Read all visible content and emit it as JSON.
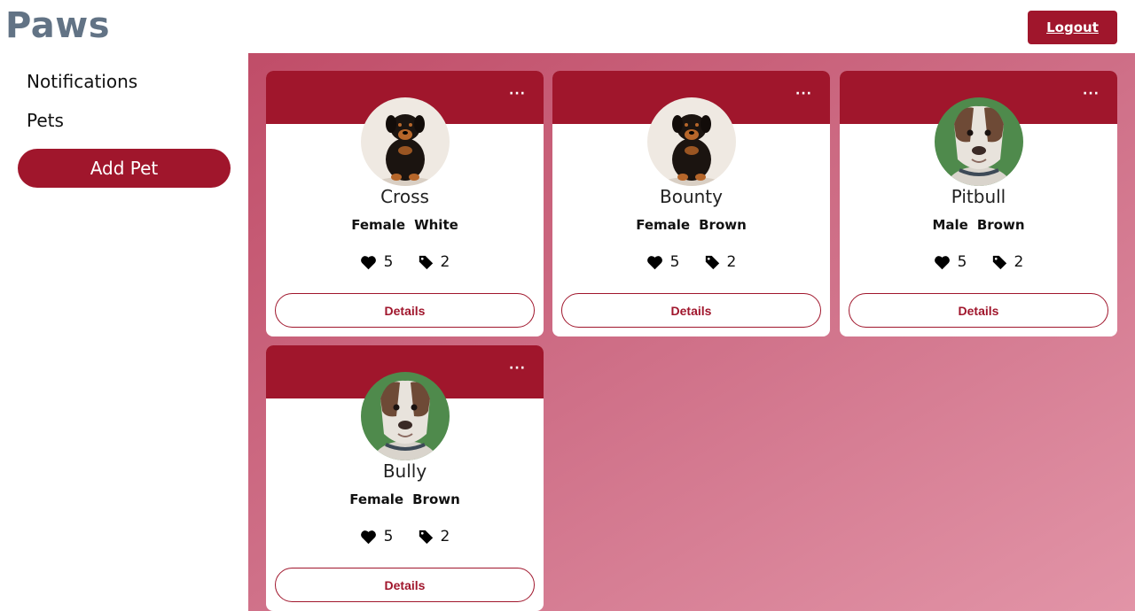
{
  "app": {
    "title": "Paws"
  },
  "header": {
    "logout_label": "Logout"
  },
  "sidebar": {
    "items": [
      {
        "label": "Notifications"
      },
      {
        "label": "Pets"
      }
    ],
    "add_pet_label": "Add Pet"
  },
  "pets": [
    {
      "name": "Cross",
      "gender": "Female",
      "color": "White",
      "likes": "5",
      "tags": "2",
      "photo": "rottweiler-puppy",
      "details_label": "Details",
      "menu": "···"
    },
    {
      "name": "Bounty",
      "gender": "Female",
      "color": "Brown",
      "likes": "5",
      "tags": "2",
      "photo": "rottweiler-puppy",
      "details_label": "Details",
      "menu": "···"
    },
    {
      "name": "Pitbull",
      "gender": "Male",
      "color": "Brown",
      "likes": "5",
      "tags": "2",
      "photo": "pitbull",
      "details_label": "Details",
      "menu": "···"
    },
    {
      "name": "Bully",
      "gender": "Female",
      "color": "Brown",
      "likes": "5",
      "tags": "2",
      "photo": "pitbull",
      "details_label": "Details",
      "menu": "···"
    }
  ],
  "colors": {
    "brand": "#627385",
    "accent": "#a0162c"
  }
}
